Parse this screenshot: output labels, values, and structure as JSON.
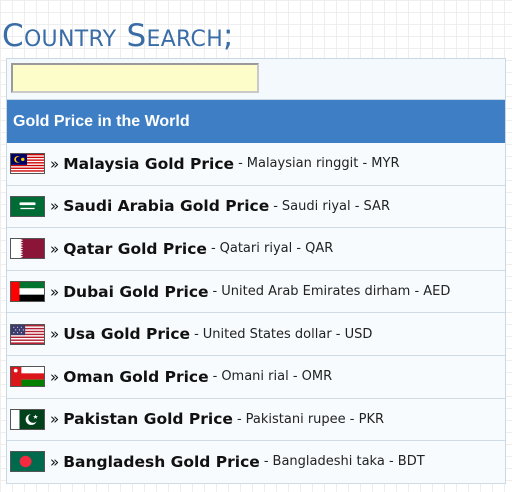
{
  "page": {
    "title": "Country Search;"
  },
  "search": {
    "value": "",
    "placeholder": ""
  },
  "table": {
    "header": "Gold Price in the World",
    "separator": "»",
    "dash": "-",
    "rows": [
      {
        "country": "Malaysia Gold Price",
        "currency": "Malaysian ringgit - MYR",
        "flag": "malaysia-flag-icon"
      },
      {
        "country": "Saudi Arabia Gold Price",
        "currency": "Saudi riyal - SAR",
        "flag": "saudi-arabia-flag-icon"
      },
      {
        "country": "Qatar Gold Price",
        "currency": "Qatari riyal - QAR",
        "flag": "qatar-flag-icon"
      },
      {
        "country": "Dubai Gold Price",
        "currency": "United Arab Emirates dirham - AED",
        "flag": "uae-flag-icon"
      },
      {
        "country": "Usa Gold Price",
        "currency": "United States dollar - USD",
        "flag": "usa-flag-icon"
      },
      {
        "country": "Oman Gold Price",
        "currency": "Omani rial - OMR",
        "flag": "oman-flag-icon"
      },
      {
        "country": "Pakistan Gold Price",
        "currency": "Pakistani rupee - PKR",
        "flag": "pakistan-flag-icon"
      },
      {
        "country": "Bangladesh Gold Price",
        "currency": "Bangladeshi taka - BDT",
        "flag": "bangladesh-flag-icon"
      }
    ]
  },
  "colors": {
    "title": "#3a6da6",
    "header_bg": "#3d7ec5",
    "search_bg": "#fdfdc9"
  }
}
